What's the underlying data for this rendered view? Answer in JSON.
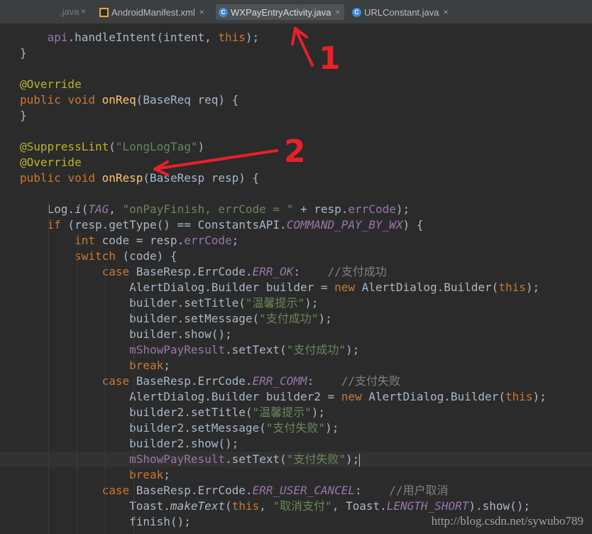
{
  "tabs": [
    {
      "label": ".java",
      "active": false,
      "icon": "java-icon"
    },
    {
      "label": "AndroidManifest.xml",
      "active": false,
      "icon": "xml-file-icon"
    },
    {
      "label": "WXPayEntryActivity.java",
      "active": true,
      "icon": "java-class-icon"
    },
    {
      "label": "URLConstant.java",
      "active": false,
      "icon": "java-class-icon"
    }
  ],
  "close_glyph": "×",
  "code_lines": [
    {
      "indent": 8,
      "t": "        api.handleIntent(intent, this);"
    },
    {
      "indent": 4,
      "t": "    }"
    },
    {
      "indent": 0,
      "t": ""
    },
    {
      "indent": 4,
      "t": "    @Override"
    },
    {
      "indent": 4,
      "t": "    public void onReq(BaseReq req) {"
    },
    {
      "indent": 4,
      "t": "    }"
    },
    {
      "indent": 0,
      "t": ""
    },
    {
      "indent": 4,
      "t": "    @SuppressLint(\"LongLogTag\")"
    },
    {
      "indent": 4,
      "t": "    @Override"
    },
    {
      "indent": 4,
      "t": "    public void onResp(BaseResp resp) {"
    },
    {
      "indent": 0,
      "t": ""
    },
    {
      "indent": 8,
      "t": "        Log.i(TAG, \"onPayFinish, errCode = \" + resp.errCode);"
    },
    {
      "indent": 8,
      "t": "        if (resp.getType() == ConstantsAPI.COMMAND_PAY_BY_WX) {"
    },
    {
      "indent": 12,
      "t": "            int code = resp.errCode;"
    },
    {
      "indent": 12,
      "t": "            switch (code) {"
    },
    {
      "indent": 16,
      "t": "                case BaseResp.ErrCode.ERR_OK:    //支付成功"
    },
    {
      "indent": 20,
      "t": "                    AlertDialog.Builder builder = new AlertDialog.Builder(this);"
    },
    {
      "indent": 20,
      "t": "                    builder.setTitle(\"温馨提示\");"
    },
    {
      "indent": 20,
      "t": "                    builder.setMessage(\"支付成功\");"
    },
    {
      "indent": 20,
      "t": "                    builder.show();"
    },
    {
      "indent": 20,
      "t": "                    mShowPayResult.setText(\"支付成功\");"
    },
    {
      "indent": 20,
      "t": "                    break;"
    },
    {
      "indent": 16,
      "t": "                case BaseResp.ErrCode.ERR_COMM:    //支付失败"
    },
    {
      "indent": 20,
      "t": "                    AlertDialog.Builder builder2 = new AlertDialog.Builder(this);"
    },
    {
      "indent": 20,
      "t": "                    builder2.setTitle(\"温馨提示\");"
    },
    {
      "indent": 20,
      "t": "                    builder2.setMessage(\"支付失败\");"
    },
    {
      "indent": 20,
      "t": "                    builder2.show();"
    },
    {
      "indent": 20,
      "t": "                    mShowPayResult.setText(\"支付失败\");"
    },
    {
      "indent": 20,
      "t": "                    break;"
    },
    {
      "indent": 16,
      "t": "                case BaseResp.ErrCode.ERR_USER_CANCEL:    //用户取消"
    },
    {
      "indent": 20,
      "t": "                    Toast.makeText(this, \"取消支付\", Toast.LENGTH_SHORT).show();"
    },
    {
      "indent": 20,
      "t": "                    finish();"
    }
  ],
  "current_line": 27,
  "annotations": {
    "one": "1",
    "two": "2",
    "color": "#e8202a"
  },
  "watermark": "http://blog.csdn.net/sywubo789",
  "colors": {
    "bg": "#2b2b2b",
    "keyword": "#cc7832",
    "annotation": "#bbb529",
    "method": "#ffc66d",
    "string": "#6a8759",
    "field": "#9876aa",
    "comment": "#808080"
  }
}
